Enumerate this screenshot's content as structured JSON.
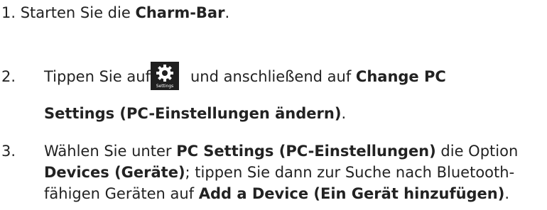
{
  "step1": {
    "prefix": "1. Starten Sie die ",
    "bold": "Charm-Bar",
    "suffix": "."
  },
  "step2": {
    "number": "2.",
    "before_icon": "Tippen Sie auf",
    "icon_name": "settings-gear-icon",
    "icon_label": "Settings",
    "after_icon": "und anschließend auf ",
    "bold1": "Change PC",
    "bold2": "Settings (PC-Einstellungen ändern)",
    "suffix": "."
  },
  "step3": {
    "number": "3.",
    "line1_text": "Wählen Sie unter ",
    "line1_bold": "PC Settings (PC-Einstellungen)",
    "line1_suffix": " die Option",
    "line2_bold": "Devices (Geräte)",
    "line2_text": "; tippen Sie dann zur Suche nach Bluetooth-",
    "line3_text": "fähigen Geräten auf ",
    "line3_bold": "Add a Device (Ein Gerät hinzufügen)",
    "line3_suffix": "."
  },
  "colors": {
    "text": "#222222",
    "icon_tile": "#1f1f1f",
    "icon_glyph": "#ffffff"
  }
}
